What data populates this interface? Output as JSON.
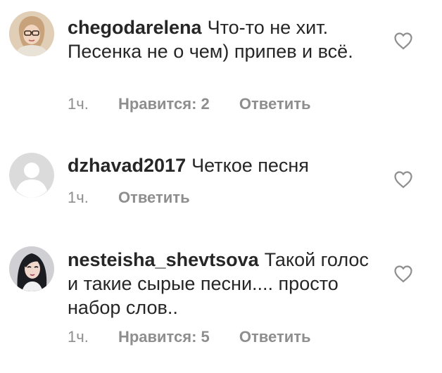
{
  "comments": [
    {
      "username": "chegodarelena",
      "text": "Что-то не хит. Песенка не о чем) припев и всё.",
      "time": "1ч.",
      "likes": "Нравится: 2",
      "reply": "Ответить",
      "avatar": "woman-with-glasses-avatar"
    },
    {
      "username": "dzhavad2017",
      "text": "Четкое песня",
      "time": "1ч.",
      "reply": "Ответить",
      "avatar": "default-user-avatar"
    },
    {
      "username": "nesteisha_shevtsova",
      "text": "Такой голос и такие сырые песни.... просто набор слов..",
      "time": "1ч.",
      "likes": "Нравится: 5",
      "reply": "Ответить",
      "avatar": "woman-dark-hair-avatar"
    }
  ],
  "colors": {
    "text": "#262626",
    "meta": "#8e8e8e",
    "heart_outline": "#8e8e8e",
    "placeholder_avatar_bg": "#dbdbdb"
  },
  "icons": {
    "like": "heart-outline-icon"
  }
}
